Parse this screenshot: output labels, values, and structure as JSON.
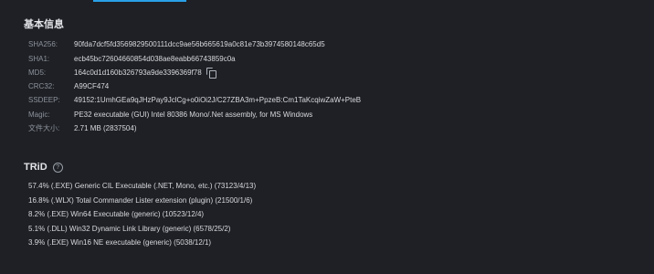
{
  "basic_info": {
    "title": "基本信息",
    "rows": [
      {
        "label": "SHA256:",
        "value": "90fda7dcf5fd3569829500111dcc9ae56b665619a0c81e73b3974580148c65d5"
      },
      {
        "label": "SHA1:",
        "value": "ecb45bc72604660854d038ae8eabb66743859c0a"
      },
      {
        "label": "MD5:",
        "value": "164c0d1d160b326793a9de3396369f78"
      },
      {
        "label": "CRC32:",
        "value": "A99CF474"
      },
      {
        "label": "SSDEEP:",
        "value": "49152:1UmhGEa9qJHzPay9JclCg+o0iOi2J/C27ZBA3m+PpzeB:Cm1TaKcqiwZaW+PteB"
      },
      {
        "label": "Magic:",
        "value": "PE32 executable (GUI) Intel 80386 Mono/.Net assembly, for MS Windows"
      },
      {
        "label": "文件大小:",
        "value": "2.71 MB (2837504)"
      }
    ]
  },
  "trid": {
    "title": "TRiD",
    "help_icon": "?",
    "items": [
      "57.4% (.EXE) Generic CIL Executable (.NET, Mono, etc.) (73123/4/13)",
      "16.8% (.WLX) Total Commander Lister extension (plugin) (21500/1/6)",
      "8.2% (.EXE) Win64 Executable (generic) (10523/12/4)",
      "5.1% (.DLL) Win32 Dynamic Link Library (generic) (6578/25/2)",
      "3.9% (.EXE) Win16 NE executable (generic) (5038/12/1)"
    ]
  },
  "colors": {
    "background": "#1e2025",
    "accent": "#2aa0e8",
    "label": "#8d929b",
    "text": "#d7d9dd"
  }
}
